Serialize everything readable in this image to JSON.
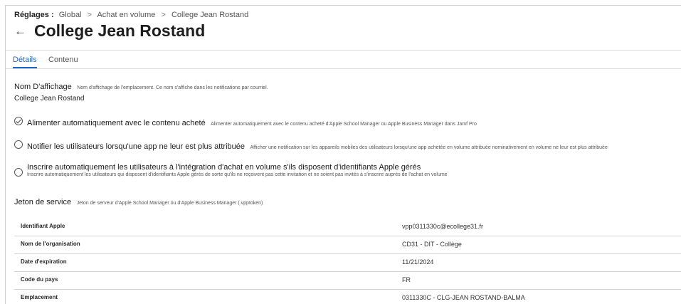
{
  "breadcrumb": {
    "lead": "Réglages :",
    "items": [
      "Global",
      "Achat en volume",
      "College Jean Rostand"
    ],
    "separator": ">"
  },
  "header": {
    "back_icon": "←",
    "title": "College Jean Rostand"
  },
  "tabs": [
    {
      "label": "Détails",
      "active": true
    },
    {
      "label": "Contenu",
      "active": false
    }
  ],
  "display_name": {
    "label": "Nom D'affichage",
    "description": "Nom d'affichage de l'emplacement. Ce nom s'affiche dans les notifications par courriel.",
    "value": "College Jean Rostand"
  },
  "options": [
    {
      "label": "Alimenter automatiquement avec le contenu acheté",
      "description": "Alimenter automatiquement avec le contenu acheté d'Apple School Manager ou Apple Business Manager dans Jamf Pro",
      "checked": true
    },
    {
      "label": "Notifier les utilisateurs lorsqu'une app ne leur est plus attribuée",
      "description": "Afficher une notification sur les appareils mobiles des utilisateurs lorsqu'une app achetée en volume attribuée nominativement en volume ne leur est plus attribuée",
      "checked": false
    },
    {
      "label": "Inscrire automatiquement les utilisateurs à l'intégration d'achat en volume s'ils disposent d'identifiants Apple gérés",
      "description": "Inscrire automatiquement les utilisateurs qui disposent d'identifiants Apple gérés de sorte qu'ils ne reçoivent pas cette invitation et ne soient pas invités à s'inscrire auprès de l'achat en volume",
      "checked": false
    }
  ],
  "service_token": {
    "label": "Jeton de service",
    "description": "Jeton de serveur d'Apple School Manager ou d'Apple Business Manager (.vpptoken)"
  },
  "token_table": [
    {
      "key": "Identifiant Apple",
      "value": "vpp0311330c@ecollege31.fr"
    },
    {
      "key": "Nom de l'organisation",
      "value": "CD31 - DIT - Collège"
    },
    {
      "key": "Date d'expiration",
      "value": "11/21/2024"
    },
    {
      "key": "Code du pays",
      "value": "FR"
    },
    {
      "key": "Emplacement",
      "value": "0311330C - CLG-JEAN ROSTAND-BALMA"
    }
  ],
  "colors": {
    "accent": "#1a66c8",
    "divider": "#d2d2d2"
  }
}
